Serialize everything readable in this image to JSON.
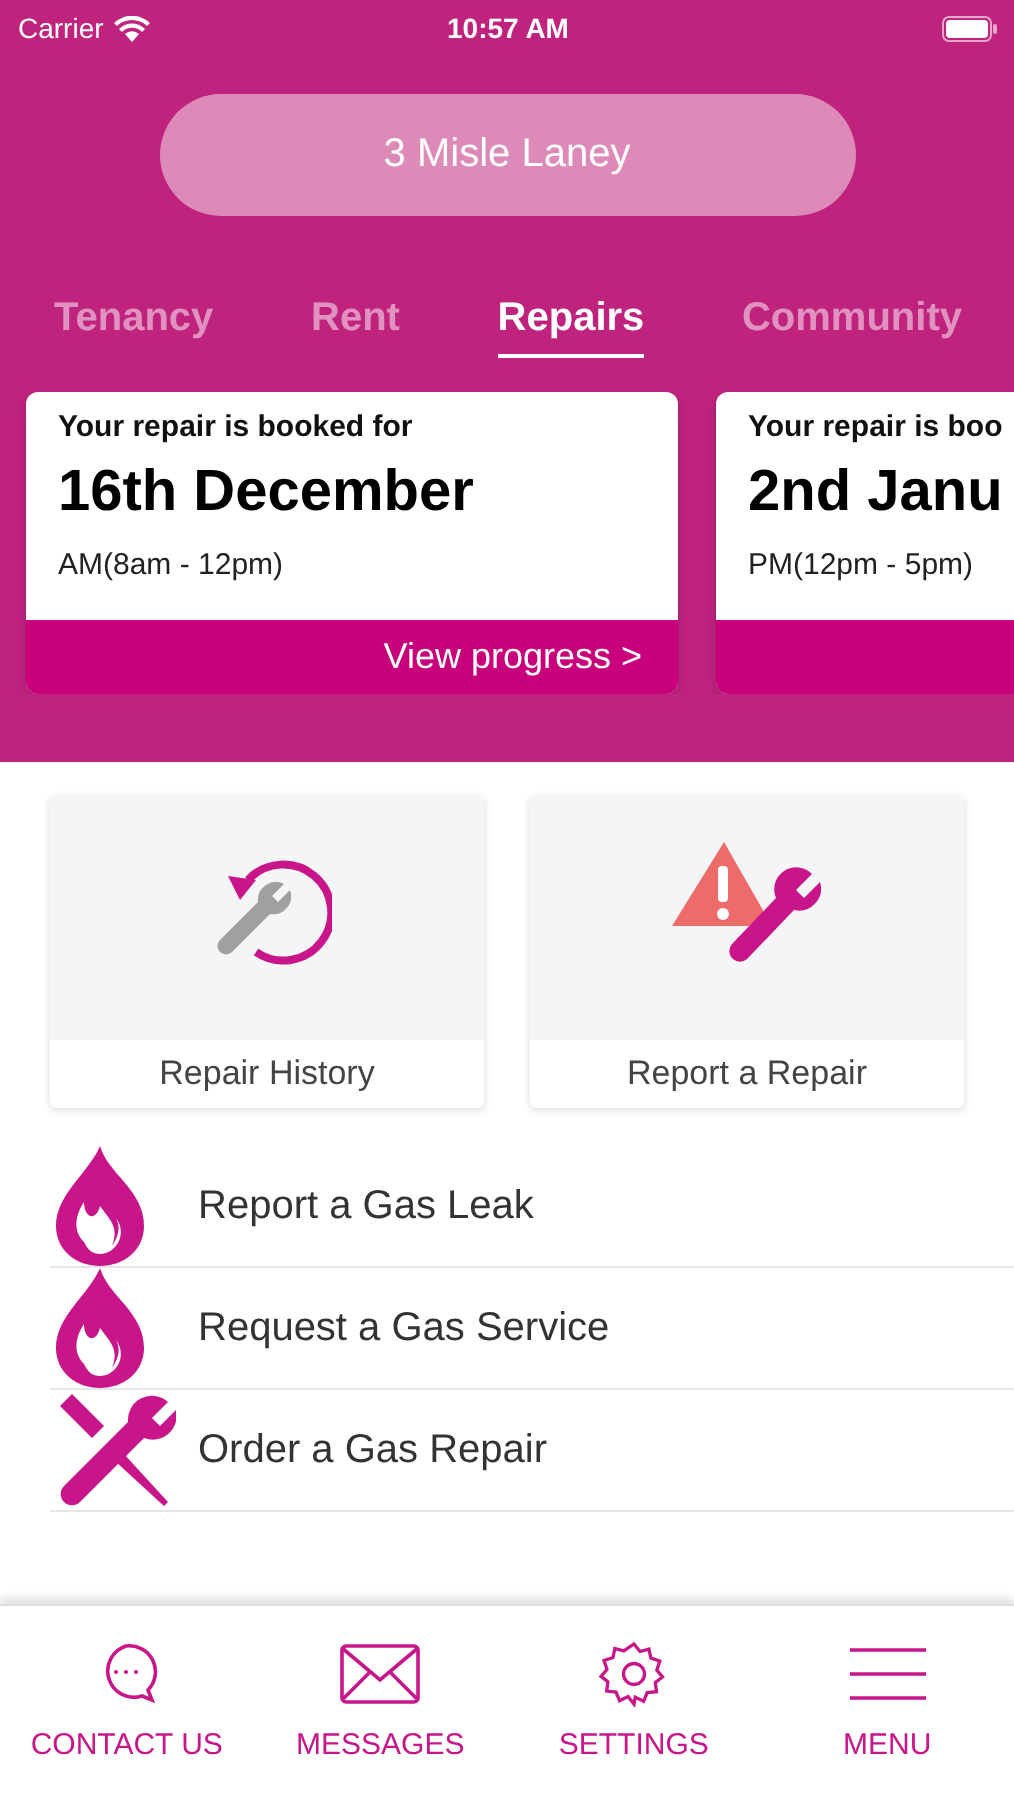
{
  "status_bar": {
    "carrier": "Carrier",
    "time": "10:57 AM"
  },
  "address": "3 Misle Laney",
  "tabs": [
    {
      "label": "Tenancy",
      "selected": false
    },
    {
      "label": "Rent",
      "selected": false
    },
    {
      "label": "Repairs",
      "selected": true
    },
    {
      "label": "Community",
      "selected": false
    }
  ],
  "bookings": [
    {
      "heading": "Your repair is booked for",
      "date": "16th December",
      "slot": "AM(8am - 12pm)",
      "link": "View progress >"
    },
    {
      "heading": "Your repair is boo",
      "date": "2nd Janu",
      "slot": "PM(12pm - 5pm)"
    }
  ],
  "tiles": [
    {
      "kind": "history",
      "label": "Repair History"
    },
    {
      "kind": "report",
      "label": "Report a Repair"
    }
  ],
  "gas_actions": [
    {
      "kind": "flame",
      "label": "Report a Gas Leak"
    },
    {
      "kind": "flame",
      "label": "Request a Gas Service"
    },
    {
      "kind": "tools",
      "label": "Order a Gas Repair"
    }
  ],
  "bottom_nav": [
    {
      "kind": "chat",
      "label": "CONTACT US"
    },
    {
      "kind": "mail",
      "label": "MESSAGES"
    },
    {
      "kind": "gear",
      "label": "SETTINGS"
    },
    {
      "kind": "menu",
      "label": "MENU"
    }
  ]
}
